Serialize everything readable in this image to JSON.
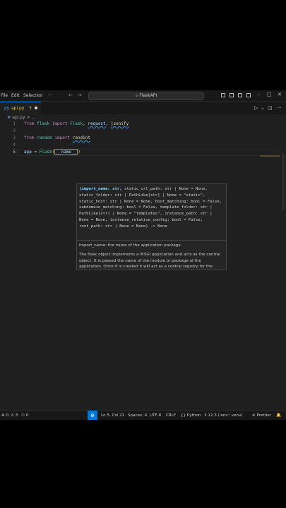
{
  "menu": {
    "file": "File",
    "edit": "Edit",
    "selection": "Selection",
    "more": "···"
  },
  "nav": {
    "back": "←",
    "forward": "→"
  },
  "search": {
    "icon": "⌕",
    "text": "FlaskAPI"
  },
  "window": {
    "minimize": "–",
    "maximize": "□",
    "close": "✕"
  },
  "tab": {
    "icon": "py",
    "label": "api.py",
    "modified_count": "3"
  },
  "tab_actions": {
    "run": "▷",
    "run_menu": "⌄",
    "split": "◫",
    "more": "···"
  },
  "breadcrumb": {
    "file": "api.py",
    "sep": " > ",
    "more": "..."
  },
  "code": {
    "lines": [
      "1",
      "2",
      "3",
      "4",
      "5"
    ],
    "l1": {
      "from": "from",
      "module": "flask",
      "import": "import",
      "a": "Flask",
      "comma1": ", ",
      "b": "request",
      "comma2": ", ",
      "c": "jsonify"
    },
    "l3": {
      "from": "from",
      "module": "random",
      "import": "import",
      "a": "randint"
    },
    "l5": {
      "var": "app",
      "eq": " = ",
      "fn": "Flask",
      "open": "(",
      "arg": "__name__",
      "close": ")"
    }
  },
  "hover": {
    "signature_param": "(import_name: str,",
    "signature_rest": " static_url_path: str | None = None, static_folder: str | PathLike[str] | None = \"static\", static_host: str | None = None, host_matching: bool = False, subdomain_matching: bool = False, template_folder: str | PathLike[str] | None = \"templates\", instance_path: str | None = None, instance_relative_config: bool = False, root_path: str | None = None) -> None",
    "param_doc": "import_name: the name of the application package",
    "description": "The flask object implements a WSGI application and acts as the central object. It is passed the name of the module or package of the application. Once it is created it will act as a central registry for the"
  },
  "status": {
    "errors": "⊗ 0",
    "warnings": "⚠ 3",
    "ports": "⚇ 0",
    "remote_icon": "⊕",
    "position": "Ln 5, Col 21",
    "spaces": "Spaces: 4",
    "encoding": "UTF-8",
    "eol": "CRLF",
    "language": "{} Python",
    "interpreter": "3.12.3 ('env': venv)",
    "prettier": "⊘ Prettier",
    "bell": "🔔"
  }
}
